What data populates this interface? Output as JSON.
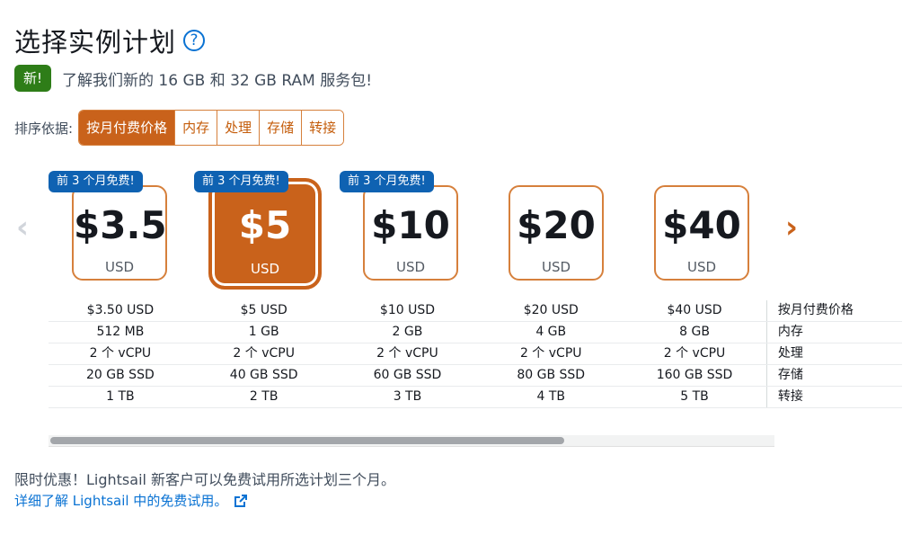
{
  "header": {
    "title": "选择实例计划",
    "help_icon": "question-circle-icon"
  },
  "announcement": {
    "badge": "新!",
    "text": "了解我们新的 16 GB 和 32 GB RAM 服务包!"
  },
  "sort": {
    "label": "排序依据:",
    "options": [
      "按月付费价格",
      "内存",
      "处理",
      "存储",
      "转接"
    ],
    "selected": "按月付费价格"
  },
  "carousel": {
    "prev_icon": "chevron-left-icon",
    "next_icon": "chevron-right-icon"
  },
  "plans": [
    {
      "price": "$3.5",
      "unit": "USD",
      "promo": "前 3 个月免费!"
    },
    {
      "price": "$5",
      "unit": "USD",
      "promo": "前 3 个月免费!",
      "selected": true
    },
    {
      "price": "$10",
      "unit": "USD",
      "promo": "前 3 个月免费!"
    },
    {
      "price": "$20",
      "unit": "USD"
    },
    {
      "price": "$40",
      "unit": "USD"
    }
  ],
  "spec_rows": [
    {
      "label": "按月付费价格",
      "values": [
        "$3.50 USD",
        "$5 USD",
        "$10 USD",
        "$20 USD",
        "$40 USD"
      ]
    },
    {
      "label": "内存",
      "values": [
        "512 MB",
        "1 GB",
        "2 GB",
        "4 GB",
        "8 GB"
      ]
    },
    {
      "label": "处理",
      "values": [
        "2 个 vCPU",
        "2 个 vCPU",
        "2 个 vCPU",
        "2 个 vCPU",
        "2 个 vCPU"
      ]
    },
    {
      "label": "存储",
      "values": [
        "20 GB SSD",
        "40 GB SSD",
        "60 GB SSD",
        "80 GB SSD",
        "160 GB SSD"
      ]
    },
    {
      "label": "转接",
      "values": [
        "1 TB",
        "2 TB",
        "3 TB",
        "4 TB",
        "5 TB"
      ]
    }
  ],
  "footer": {
    "text": "限时优惠！Lightsail 新客户可以免费试用所选计划三个月。",
    "link": "详细了解 Lightsail 中的免费试用。",
    "link_icon": "external-link-icon"
  },
  "colors": {
    "accent": "#c9621b",
    "promo": "#0f62b2",
    "link": "#0972d3",
    "new_badge": "#2e7d18"
  }
}
